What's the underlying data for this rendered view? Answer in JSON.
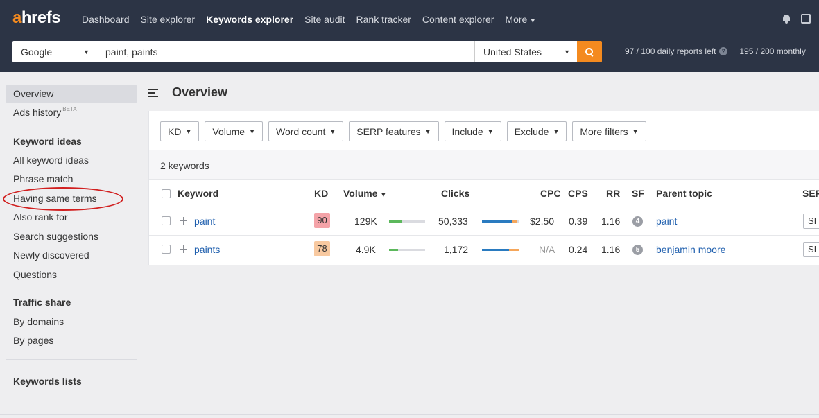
{
  "brand": {
    "logo_first": "a",
    "logo_rest": "hrefs"
  },
  "nav": {
    "items": [
      {
        "label": "Dashboard",
        "active": false
      },
      {
        "label": "Site explorer",
        "active": false
      },
      {
        "label": "Keywords explorer",
        "active": true
      },
      {
        "label": "Site audit",
        "active": false
      },
      {
        "label": "Rank tracker",
        "active": false
      },
      {
        "label": "Content explorer",
        "active": false
      }
    ],
    "more_label": "More",
    "more_caret": "▼"
  },
  "search": {
    "engine": "Google",
    "query": "paint, paints",
    "country": "United States",
    "quota_daily": "97 / 100 daily reports left",
    "quota_monthly": "195 / 200 monthly",
    "help_glyph": "?"
  },
  "sidebar": {
    "overview": "Overview",
    "ads_history": "Ads history",
    "beta": "BETA",
    "keyword_ideas_heading": "Keyword ideas",
    "keyword_ideas": [
      "All keyword ideas",
      "Phrase match",
      "Having same terms",
      "Also rank for",
      "Search suggestions",
      "Newly discovered",
      "Questions"
    ],
    "traffic_share_heading": "Traffic share",
    "traffic_share": [
      "By domains",
      "By pages"
    ],
    "keywords_lists": "Keywords lists"
  },
  "main": {
    "title": "Overview",
    "filters": [
      "KD",
      "Volume",
      "Word count",
      "SERP features",
      "Include",
      "Exclude",
      "More filters"
    ],
    "count_text": "2 keywords",
    "columns": {
      "keyword": "Keyword",
      "kd": "KD",
      "volume": "Volume",
      "volume_sort": "▼",
      "clicks": "Clicks",
      "cpc": "CPC",
      "cps": "CPS",
      "rr": "RR",
      "sf": "SF",
      "parent_topic": "Parent topic",
      "serp": "SERP"
    },
    "rows": [
      {
        "keyword": "paint",
        "kd": "90",
        "kd_color": "#f4a3a8",
        "volume": "129K",
        "volume_share": 0.35,
        "clicks": "50,333",
        "clicks_blue": 0.82,
        "clicks_orange": 0.12,
        "cpc": "$2.50",
        "cps": "0.39",
        "rr": "1.16",
        "sf": "4",
        "parent_topic": "paint",
        "serp_btn": "SI"
      },
      {
        "keyword": "paints",
        "kd": "78",
        "kd_color": "#f8c9a0",
        "volume": "4.9K",
        "volume_share": 0.25,
        "clicks": "1,172",
        "clicks_blue": 0.72,
        "clicks_orange": 0.28,
        "cpc": "N/A",
        "cps": "0.24",
        "rr": "1.16",
        "sf": "5",
        "parent_topic": "benjamin moore",
        "serp_btn": "SI"
      }
    ]
  },
  "colors": {
    "nav_bg": "#2c3445",
    "accent_orange": "#f48a1f",
    "link_blue": "#1f5fae",
    "volume_green": "#5cb85c",
    "clicks_blue": "#2a7bc0",
    "clicks_orange": "#f5a65b",
    "annotation_red": "#d11f1f"
  }
}
